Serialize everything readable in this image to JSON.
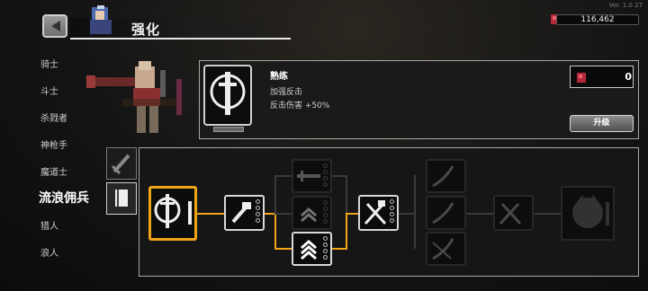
{
  "header": {
    "title": "强化",
    "version": "Ver. 1.0.27",
    "currency": "116,462"
  },
  "sidebar": {
    "items": [
      {
        "label": "骑士"
      },
      {
        "label": "斗士"
      },
      {
        "label": "杀戮者"
      },
      {
        "label": "神枪手"
      },
      {
        "label": "魔道士"
      },
      {
        "label": "流浪佣兵"
      },
      {
        "label": "猎人"
      },
      {
        "label": "浪人"
      }
    ],
    "active_index": 5
  },
  "skill": {
    "name": "熟练",
    "lines": [
      "加强反击",
      "反击伤害 +50%"
    ],
    "material_count": "0",
    "upgrade_label": "升级"
  },
  "tabs": [
    {
      "icon": "sword-icon"
    },
    {
      "icon": "book-icon"
    }
  ],
  "colors": {
    "accent": "#f0a418",
    "panel_border": "#a8a8a8"
  }
}
